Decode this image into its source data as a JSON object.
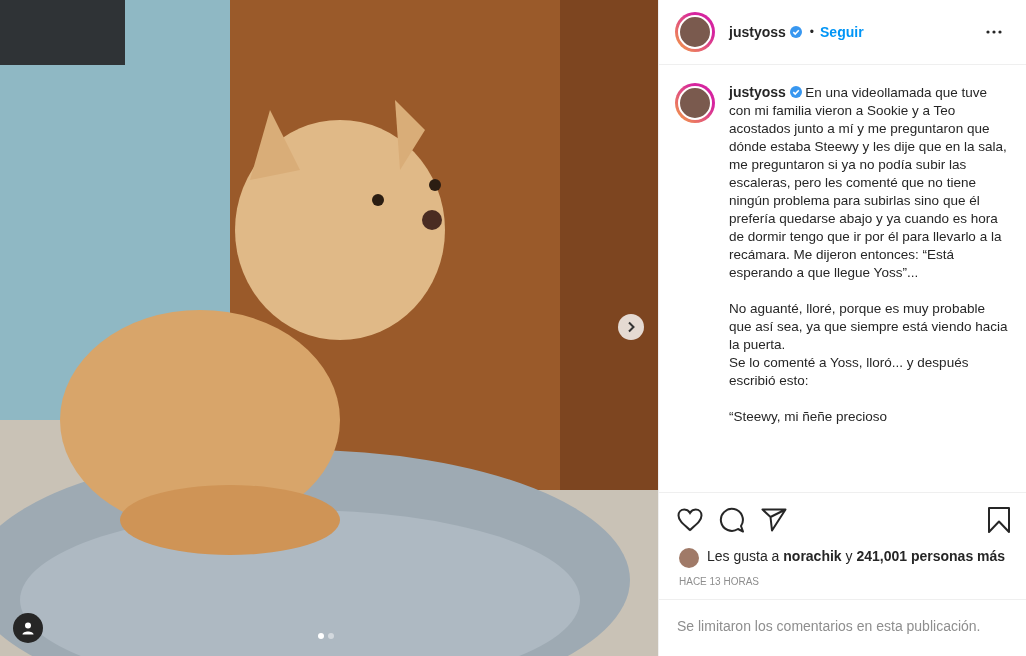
{
  "post": {
    "slides": [
      {
        "selected": true
      },
      {
        "selected": false
      }
    ]
  },
  "header": {
    "username": "justyoss",
    "separator": "•",
    "follow": "Seguir"
  },
  "caption": {
    "username": "justyoss",
    "paragraphs": [
      "En una videollamada que tuve con mi familia vieron a Sookie y a Teo acostados junto a mí y me preguntaron que dónde estaba Steewy y les dije que en la sala, me preguntaron si ya no podía subir las escaleras, pero les comenté que no tiene ningún problema para subirlas sino que él prefería quedarse abajo y ya cuando es hora de dormir tengo que ir por él para llevarlo a la recámara. Me dijeron entonces: “Está esperando a que llegue Yoss”...",
      "No aguanté, lloré, porque es muy probable que así sea, ya que siempre está viendo hacia la puerta.\nSe lo comenté a Yoss, lloró... y después escribió esto:",
      "“Steewy, mi ñeñe precioso"
    ]
  },
  "likes": {
    "prefix": "Les gusta a ",
    "user": "norachik",
    "middle": " y ",
    "count": "241,001 personas más"
  },
  "time": "HACE 13 HORAS",
  "comments_notice": "Se limitaron los comentarios en esta publicación."
}
